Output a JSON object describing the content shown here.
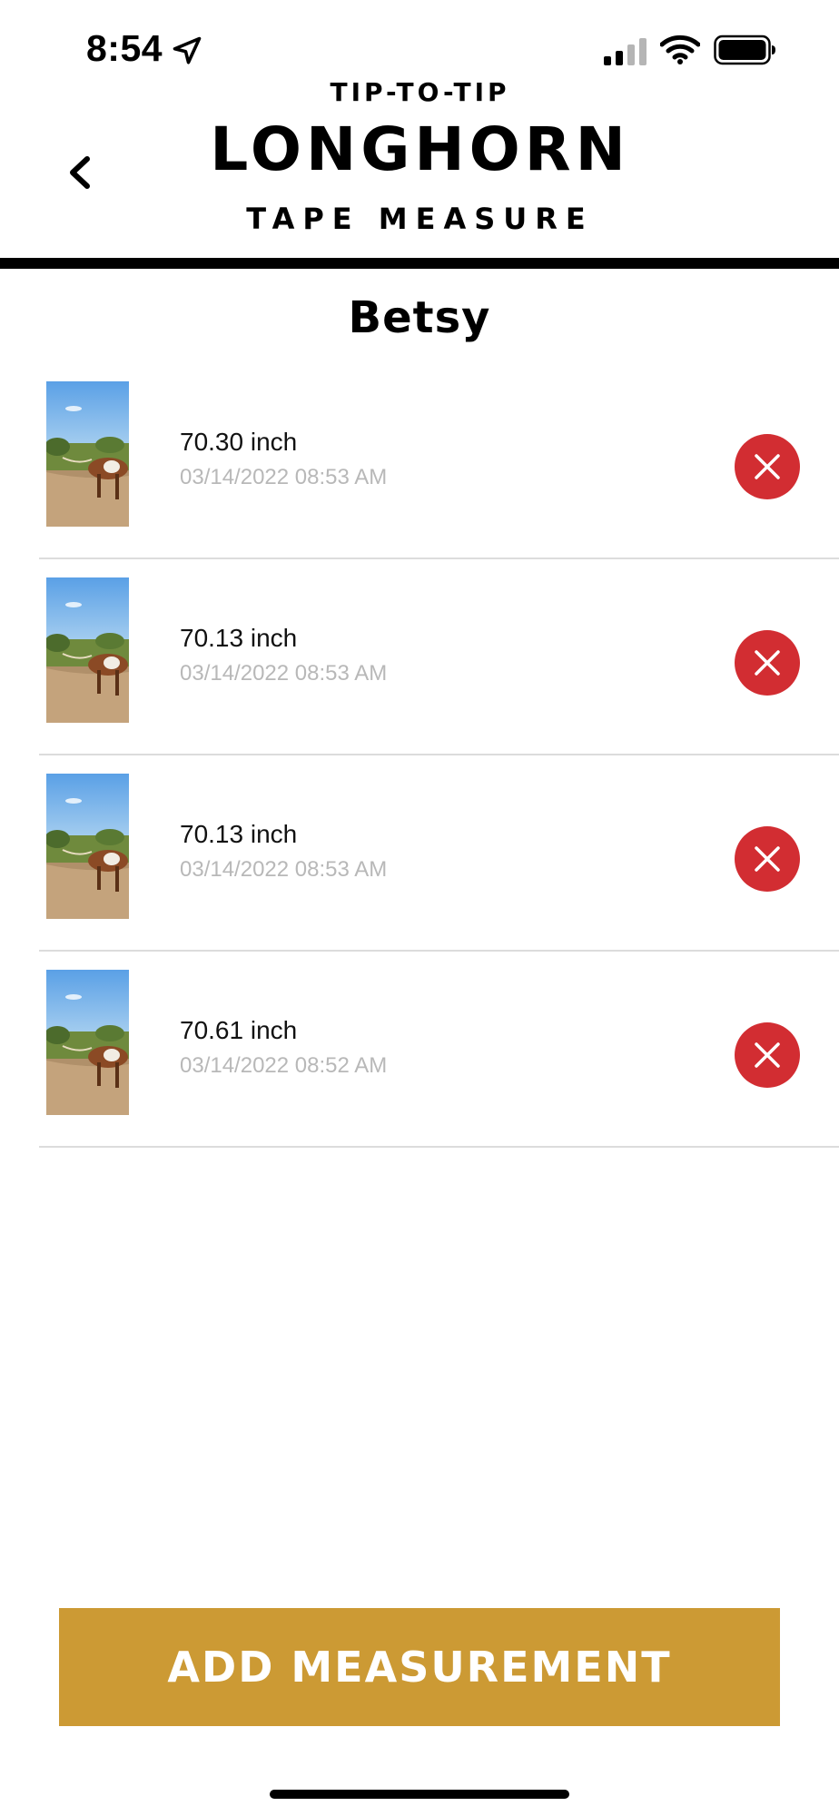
{
  "status_bar": {
    "time": "8:54",
    "icons": [
      "location-arrow-icon",
      "cellular-signal-icon",
      "wifi-icon",
      "battery-icon"
    ]
  },
  "header": {
    "back_icon": "chevron-left-icon",
    "logo": {
      "top": "TIP-TO-TIP",
      "main": "LONGHORN",
      "bottom": "TAPE MEASURE"
    }
  },
  "page": {
    "title": "Betsy"
  },
  "measurements": [
    {
      "value": "70.30 inch",
      "date": "03/14/2022 08:53 AM"
    },
    {
      "value": "70.13 inch",
      "date": "03/14/2022 08:53 AM"
    },
    {
      "value": "70.13 inch",
      "date": "03/14/2022 08:53 AM"
    },
    {
      "value": "70.61 inch",
      "date": "03/14/2022 08:52 AM"
    }
  ],
  "actions": {
    "add_label": "ADD MEASUREMENT"
  },
  "colors": {
    "delete": "#d22d32",
    "accent": "#cc9a34",
    "date_text": "#b8b8b8"
  }
}
